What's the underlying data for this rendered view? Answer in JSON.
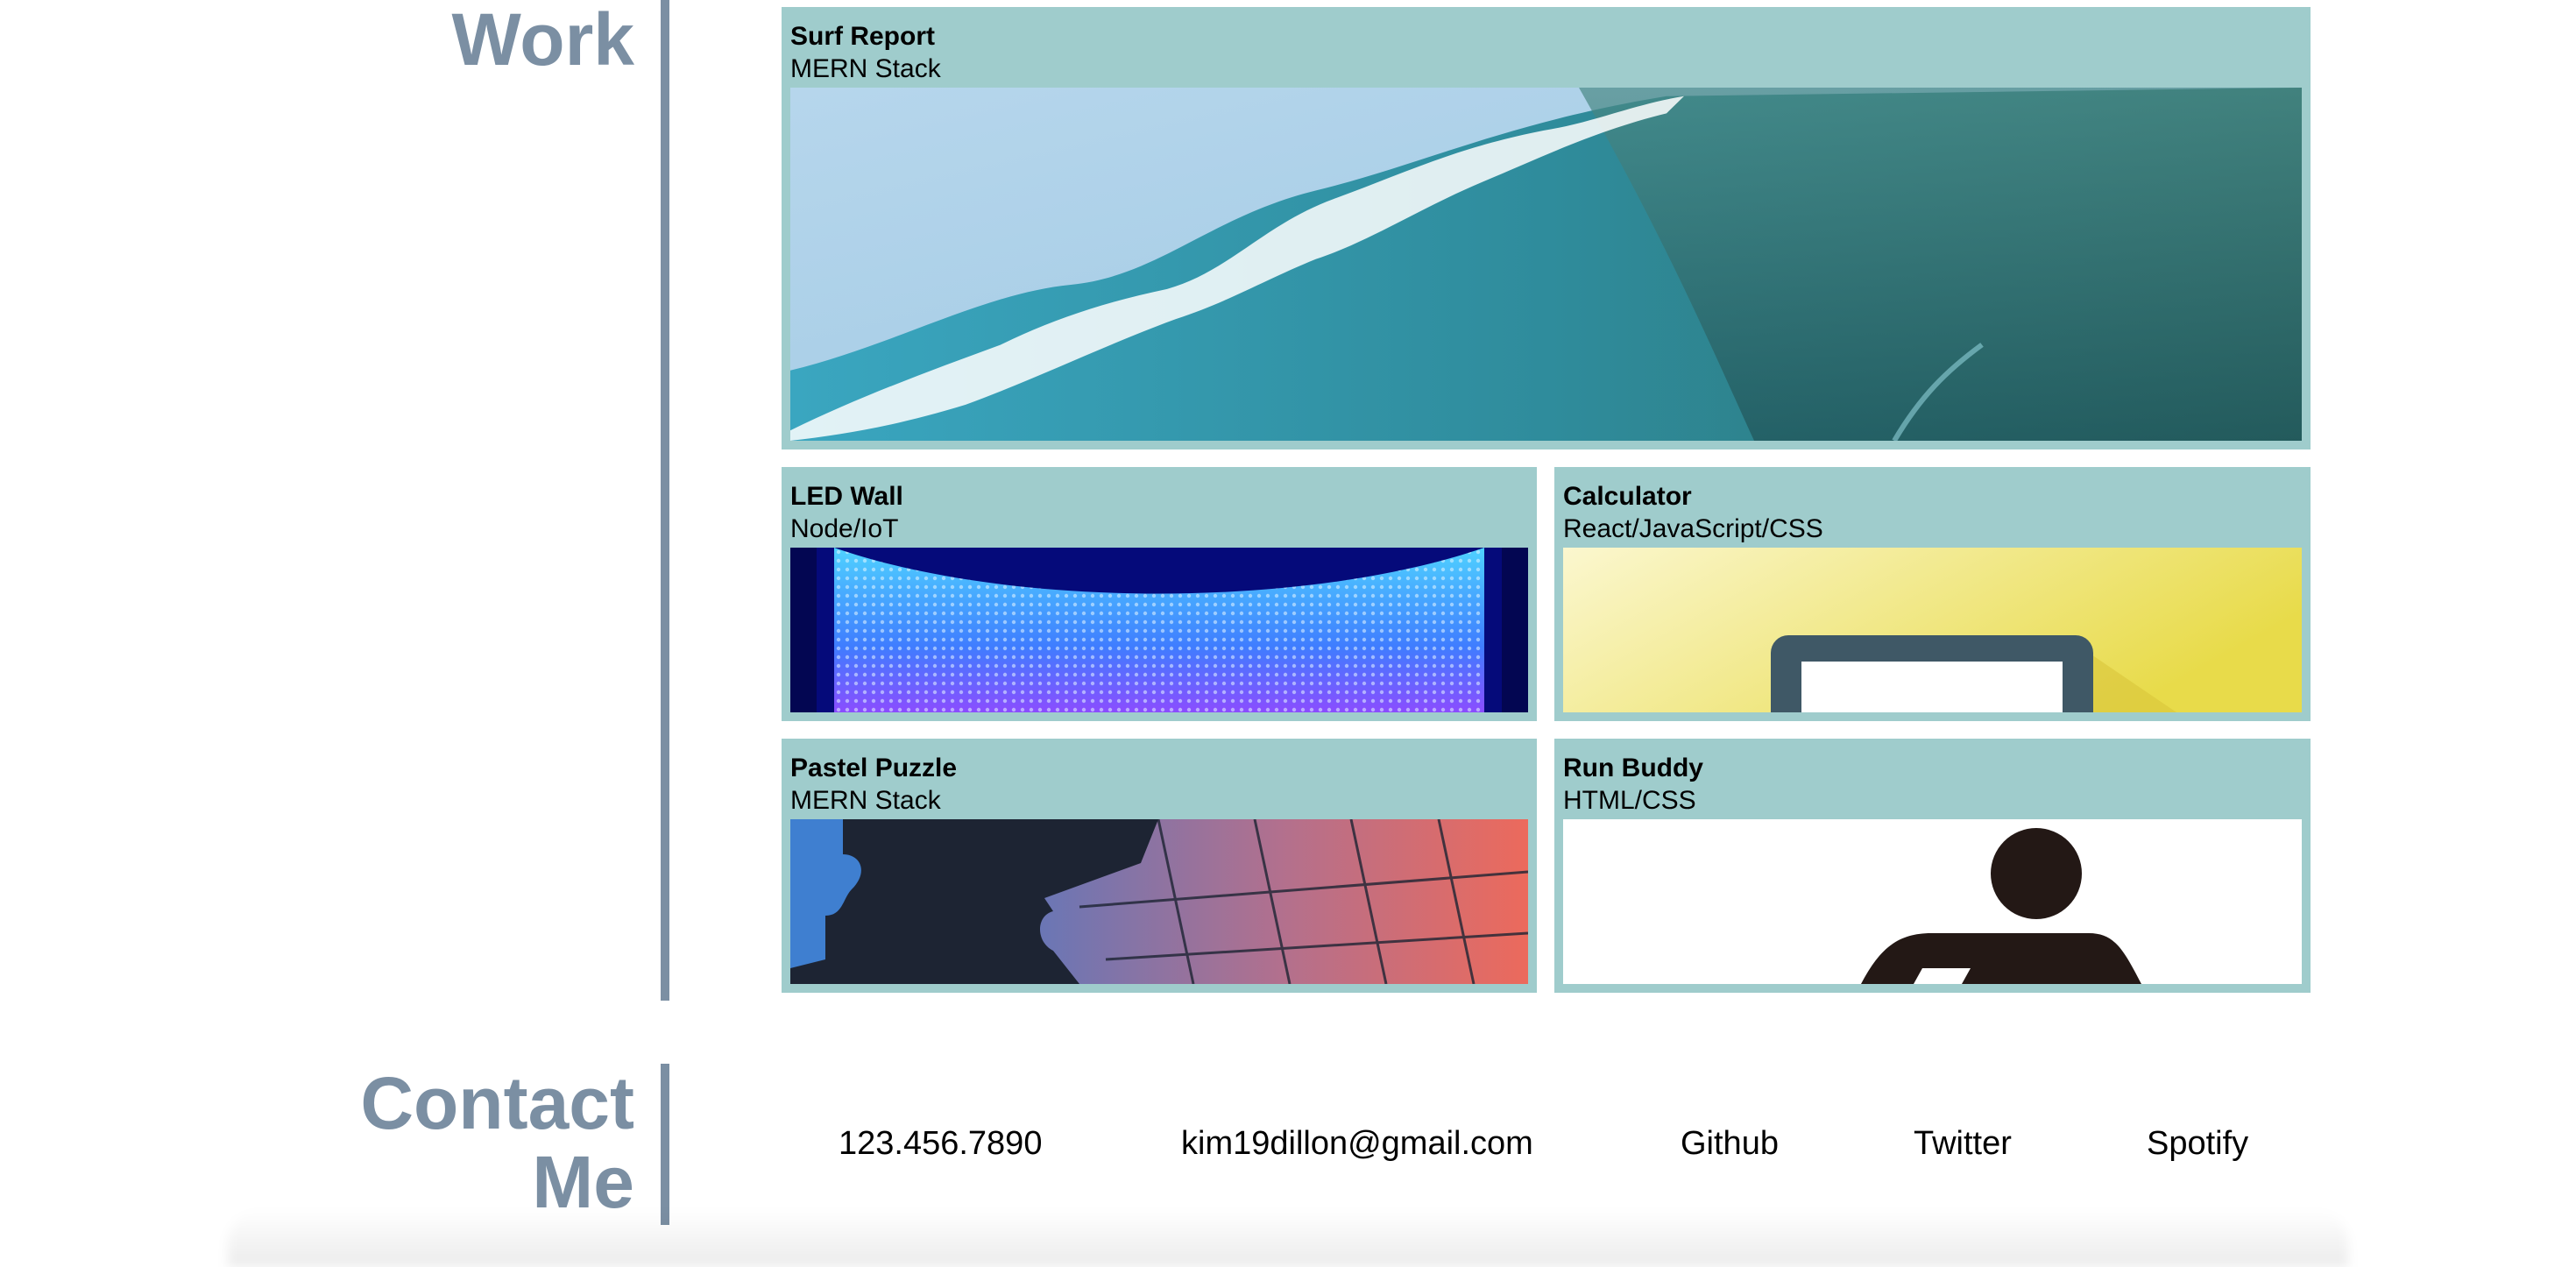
{
  "work": {
    "title": "Work",
    "projects": [
      {
        "name": "Surf Report",
        "stack": "MERN Stack",
        "image": "wave-image"
      },
      {
        "name": "LED Wall",
        "stack": "Node/IoT",
        "image": "led-wall-image"
      },
      {
        "name": "Calculator",
        "stack": "React/JavaScript/CSS",
        "image": "laptop-image"
      },
      {
        "name": "Pastel Puzzle",
        "stack": "MERN Stack",
        "image": "puzzle-image"
      },
      {
        "name": "Run Buddy",
        "stack": "HTML/CSS",
        "image": "runner-image"
      }
    ]
  },
  "contact": {
    "title_line1": "Contact",
    "title_line2": "Me",
    "phone": "123.456.7890",
    "email": "kim19dillon@gmail.com",
    "github": "Github",
    "twitter": "Twitter",
    "spotify": "Spotify"
  },
  "colors": {
    "accent": "#7b8fa3",
    "card_bg": "#9fcccc"
  }
}
